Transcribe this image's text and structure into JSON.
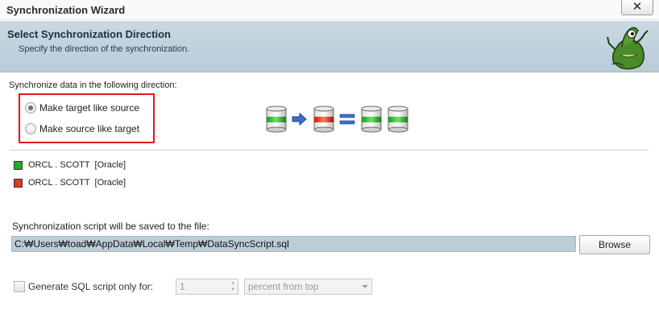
{
  "window": {
    "title": "Synchronization Wizard",
    "close_label": "✕"
  },
  "header": {
    "title": "Select Synchronization Direction",
    "subtitle": "Specify the direction of the synchronization."
  },
  "direction": {
    "label": "Synchronize data in the following direction:",
    "options": [
      {
        "label": "Make target like source",
        "checked": true
      },
      {
        "label": "Make source like target",
        "checked": false
      }
    ],
    "highlight_color": "#e0181b"
  },
  "legend": [
    {
      "text": "ORCL . SCOTT  [Oracle]",
      "color": "#22b022"
    },
    {
      "text": "ORCL . SCOTT  [Oracle]",
      "color": "#e23b1c"
    }
  ],
  "script_file": {
    "label": "Synchronization script will be saved to the file:",
    "path": "C:₩Users₩toad₩AppData₩Local₩Temp₩DataSyncScript.sql",
    "browse_label": "Browse"
  },
  "generate": {
    "label": "Generate SQL script only for:",
    "checked": false,
    "amount": "1",
    "unit": "percent from top"
  },
  "colors": {
    "header_band": "#c0d2de",
    "path_field": "#bdcdd6",
    "source_db": "#22b022",
    "target_db": "#e23b1c",
    "arrow": "#3d6fd0"
  },
  "icons": {
    "logo": "toad-frog-icon",
    "diagram": [
      "database-icon",
      "arrow-right-icon",
      "database-icon",
      "equals-icon",
      "database-icon",
      "database-icon"
    ]
  }
}
